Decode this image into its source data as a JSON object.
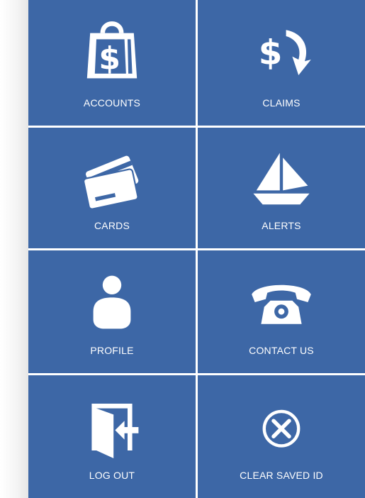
{
  "menu": {
    "tiles": [
      {
        "label": "ACCOUNTS",
        "icon": "shopping-bag-dollar-icon"
      },
      {
        "label": "CLAIMS",
        "icon": "dollar-arrow-icon"
      },
      {
        "label": "CARDS",
        "icon": "credit-cards-icon"
      },
      {
        "label": "ALERTS",
        "icon": "sailboat-icon"
      },
      {
        "label": "PROFILE",
        "icon": "person-icon"
      },
      {
        "label": "CONTACT US",
        "icon": "telephone-icon"
      },
      {
        "label": "LOG OUT",
        "icon": "door-exit-icon"
      },
      {
        "label": "CLEAR SAVED ID",
        "icon": "circle-x-icon"
      }
    ]
  },
  "colors": {
    "tile_background": "#3d67a6",
    "grid_gap": "#ffffff",
    "icon_and_text": "#ffffff"
  }
}
